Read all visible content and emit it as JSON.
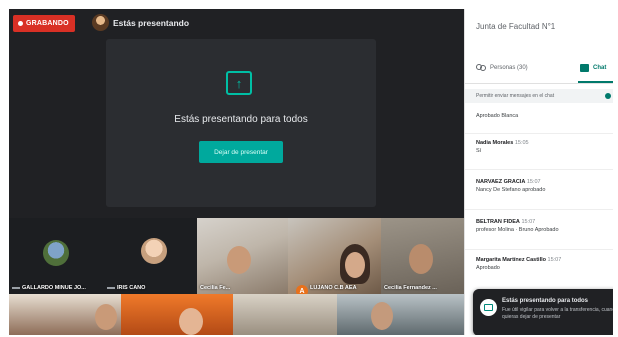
{
  "recording": {
    "label": "GRABANDO"
  },
  "presenting_title": "Estás presentando",
  "share_panel": {
    "message": "Estás presentando para todos",
    "stop_button": "Dejar de presentar"
  },
  "participants": {
    "tiles": [
      {
        "label": "GALLARDO MINUE JO..."
      },
      {
        "label": "IRIS CANO"
      },
      {
        "label": "Cecilia Fe..."
      },
      {
        "label": "LUJANO C.B AEA"
      },
      {
        "label": "Cecilia Fernandez ..."
      }
    ],
    "lower_badge": "A"
  },
  "side_panel": {
    "title": "Junta de Facultad N°1",
    "tabs": {
      "people": "Personas (30)",
      "chat": "Chat"
    },
    "notice": "Permitir enviar mensajes en el chat",
    "messages": [
      {
        "sender": "",
        "time": "",
        "text": "Aprobado Blanca"
      },
      {
        "sender": "Nadia Morales",
        "time": "15:05",
        "text": "Sí"
      },
      {
        "sender": "NARVAEZ GRACIA",
        "time": "15:07",
        "text": "Nancy De Stefano aprobado"
      },
      {
        "sender": "BELTRAN FIDEA",
        "time": "15:07",
        "text": "profesor Molina · Bruno Aprobado"
      },
      {
        "sender": "Margarita Martínez Castillo",
        "time": "15:07",
        "text": "Aprobado"
      }
    ]
  },
  "toast": {
    "title": "Estás presentando para todos",
    "body": "Fue útil vigilar para volver a la transferencia, cuando quieras dejar de presentar"
  },
  "colors": {
    "accent": "#00a99d",
    "recording": "#d93025",
    "chat_active": "#00796b"
  }
}
